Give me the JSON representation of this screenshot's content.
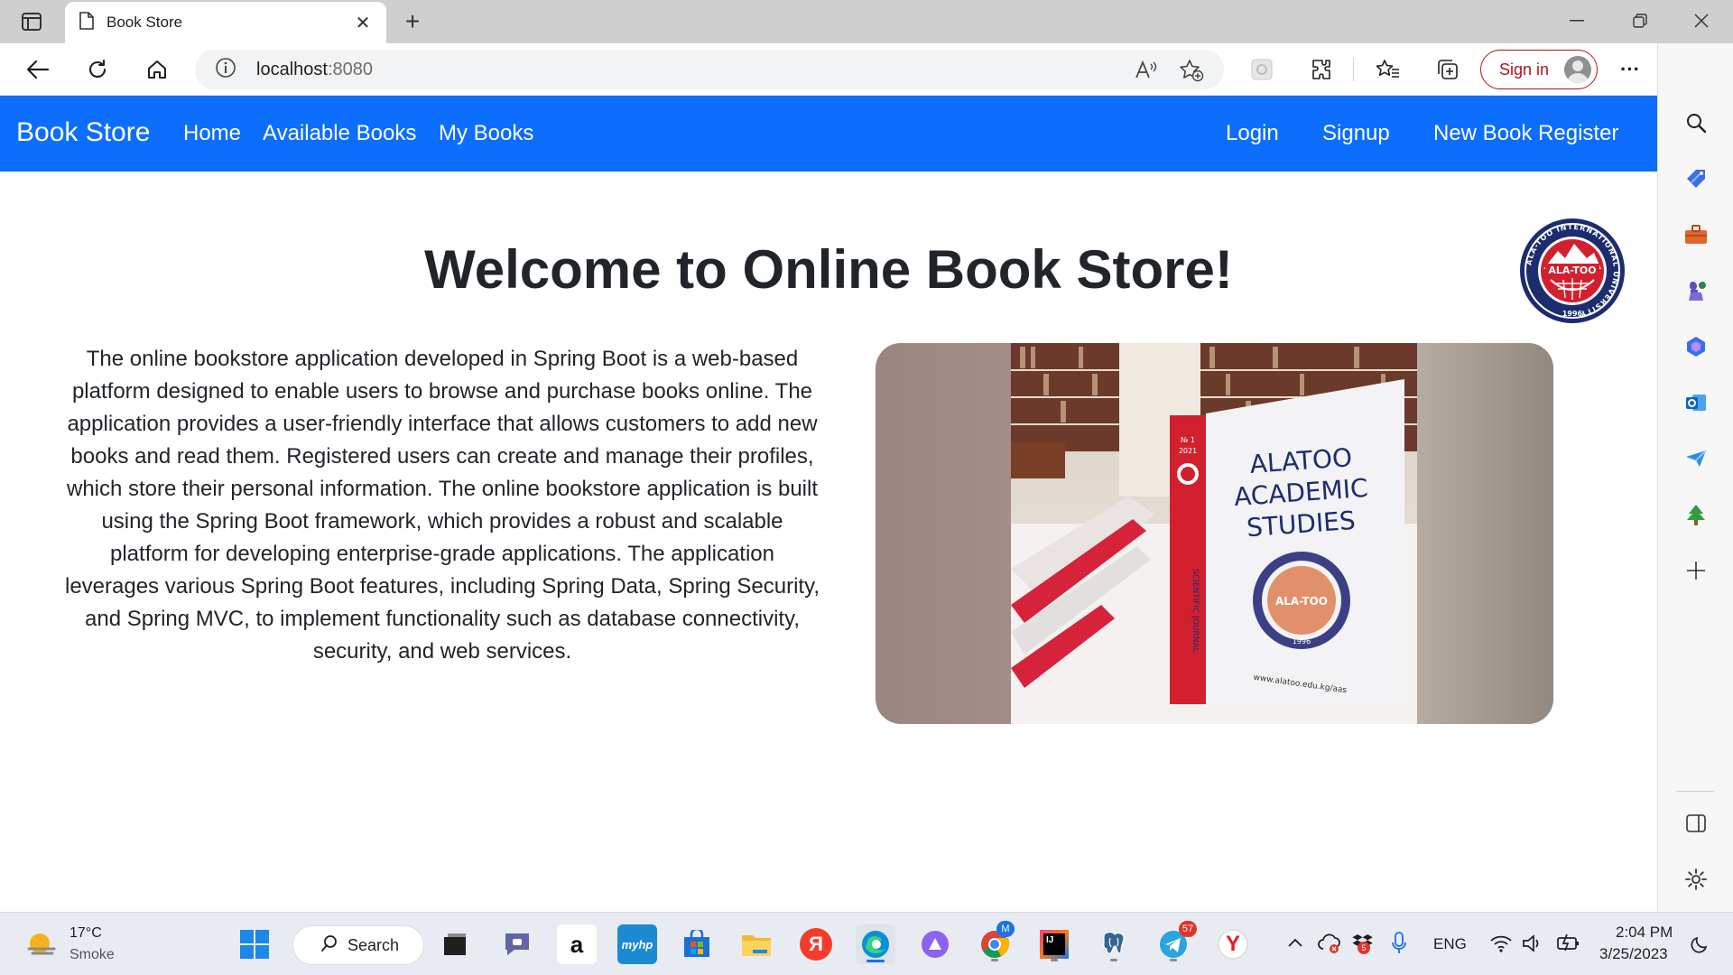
{
  "browser": {
    "tab_title": "Book Store",
    "tab_close_glyph": "✕",
    "new_tab_glyph": "+",
    "address_host": "localhost",
    "address_port": ":8080",
    "signin_label": "Sign in",
    "more_glyph": "···"
  },
  "navbar": {
    "brand": "Book Store",
    "links": [
      "Home",
      "Available Books",
      "My Books"
    ],
    "right_links": [
      "Login",
      "Signup",
      "New Book Register"
    ],
    "background": "#0d6efd"
  },
  "main": {
    "heading": "Welcome to Online Book Store!",
    "intro": "The online bookstore application developed in Spring Boot is a web-based platform designed to enable users to browse and purchase books online. The application provides a user-friendly interface that allows customers to add new books and read them. Registered users can create and manage their profiles, which store their personal information. The online bookstore application is built using the Spring Boot framework, which provides a robust and scalable platform for developing enterprise-grade applications. The application leverages various Spring Boot features, including Spring Data, Spring Security, and Spring MVC, to implement functionality such as database connectivity, security, and web services.",
    "logo": {
      "ring_text": "ALA-TOO INTERNATIONAL UNIVERSITY",
      "center_text": "ALA-TOO",
      "year": "1996"
    },
    "photo": {
      "book_title_lines": [
        "ALATOO",
        "ACADEMIC",
        "STUDIES"
      ],
      "spine_issue": "№ 1",
      "spine_year": "2021",
      "spine_text": "SCIENTIFIC JOURNAL",
      "seal_text": "ALA-TOO",
      "seal_year": "1996",
      "url": "www.alatoo.edu.kg/aas"
    }
  },
  "taskbar": {
    "weather_temp": "17°C",
    "weather_desc": "Smoke",
    "search_label": "Search",
    "chrome_badge": "M",
    "telegram_badge": "57",
    "tray_badge": "5",
    "language": "ENG",
    "time": "2:04 PM",
    "date": "3/25/2023",
    "apps": [
      "start-icon",
      "task-view-icon",
      "chat-icon",
      "amazon-icon",
      "myhp-icon",
      "store-icon",
      "file-explorer-icon",
      "yandex-icon",
      "edge-icon",
      "cortana-icon",
      "chrome-icon",
      "intellij-icon",
      "postgres-icon",
      "telegram-icon",
      "yandex-browser-icon"
    ],
    "amazon_glyph": "a",
    "myhp_label": "myhp",
    "yandex_glyph": "Я",
    "intellij_glyph": "IJ",
    "yandex_browser_glyph": "Y"
  },
  "colors": {
    "accent": "#0d6efd",
    "signin": "#b1121b",
    "logo_red": "#d3202f",
    "logo_navy": "#1c2c6e"
  }
}
